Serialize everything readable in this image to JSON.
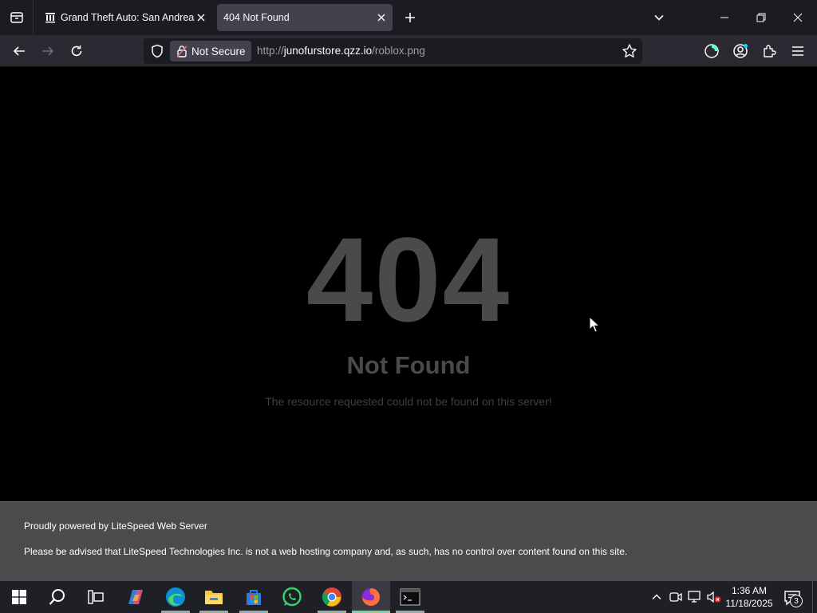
{
  "browser": {
    "tabs": [
      {
        "title": "Grand Theft Auto: San Andreas",
        "active": false
      },
      {
        "title": "404 Not Found",
        "active": true
      }
    ],
    "security_label": "Not Secure",
    "url": {
      "scheme": "http://",
      "host": "junofurstore.qzz.io",
      "path": "/roblox.png"
    }
  },
  "page": {
    "code": "404",
    "title": "Not Found",
    "description": "The resource requested could not be found on this server!",
    "footer_line1": "Proudly powered by LiteSpeed Web Server",
    "footer_line2": "Please be advised that LiteSpeed Technologies Inc. is not a web hosting company and, as such, has no control over content found on this site."
  },
  "taskbar": {
    "apps": [
      "start",
      "search",
      "task-view",
      "copilot",
      "edge",
      "file-explorer",
      "microsoft-store",
      "whatsapp",
      "chrome",
      "firefox",
      "terminal"
    ],
    "time": "1:36 AM",
    "date": "11/18/2025",
    "notification_count": "3"
  },
  "colors": {
    "chrome_dark": "#1c1b22",
    "toolbar": "#2b2a33",
    "error_text": "#4a4a4a",
    "footer_bg": "#4b4b4b",
    "taskbar": "#1f1f26"
  }
}
